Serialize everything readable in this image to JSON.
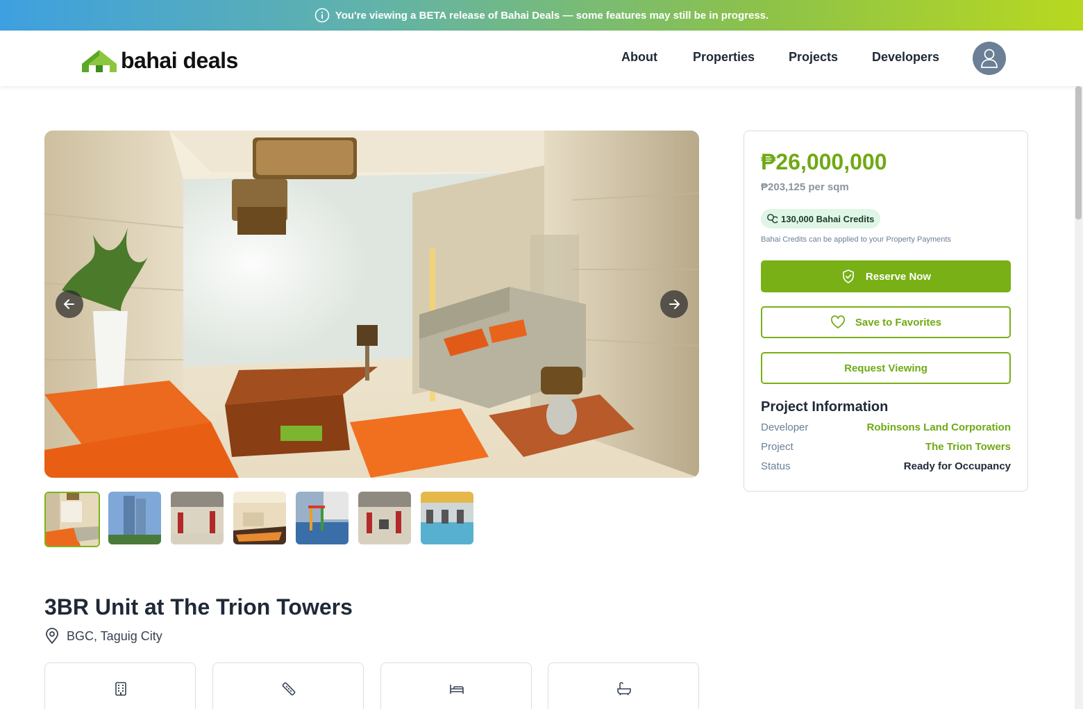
{
  "banner": {
    "text": "You're viewing a BETA release of Bahai Deals — some features may still be in progress.",
    "icon": "info-icon"
  },
  "brand": {
    "name": "bahai deals",
    "accent": "#78b015"
  },
  "nav": {
    "items": [
      "About",
      "Properties",
      "Projects",
      "Developers"
    ],
    "avatar_icon": "user-icon"
  },
  "gallery": {
    "prev_icon": "arrow-left-icon",
    "next_icon": "arrow-right-icon",
    "thumbnails": [
      "Lobby",
      "Tower exterior",
      "Gym",
      "Lounge",
      "Playground",
      "Gym",
      "Fitness center"
    ],
    "active_index": 0
  },
  "listing": {
    "title": "3BR Unit at The Trion Towers",
    "location": "BGC, Taguig City",
    "feature_icons": [
      "building-icon",
      "ruler-icon",
      "bed-icon",
      "bath-icon"
    ]
  },
  "sidebar": {
    "price": "₱26,000,000",
    "per_sqm": "₱203,125 per sqm",
    "credits": "130,000 Bahai Credits",
    "credits_note": "Bahai Credits can be applied to your Property Payments",
    "reserve_label": "Reserve Now",
    "favorites_label": "Save to Favorites",
    "viewing_label": "Request Viewing",
    "info_heading": "Project Information",
    "info": [
      {
        "key": "Developer",
        "value": "Robinsons Land Corporation"
      },
      {
        "key": "Project",
        "value": "The Trion Towers"
      },
      {
        "key": "Status",
        "value": "Ready for Occupancy"
      }
    ]
  }
}
